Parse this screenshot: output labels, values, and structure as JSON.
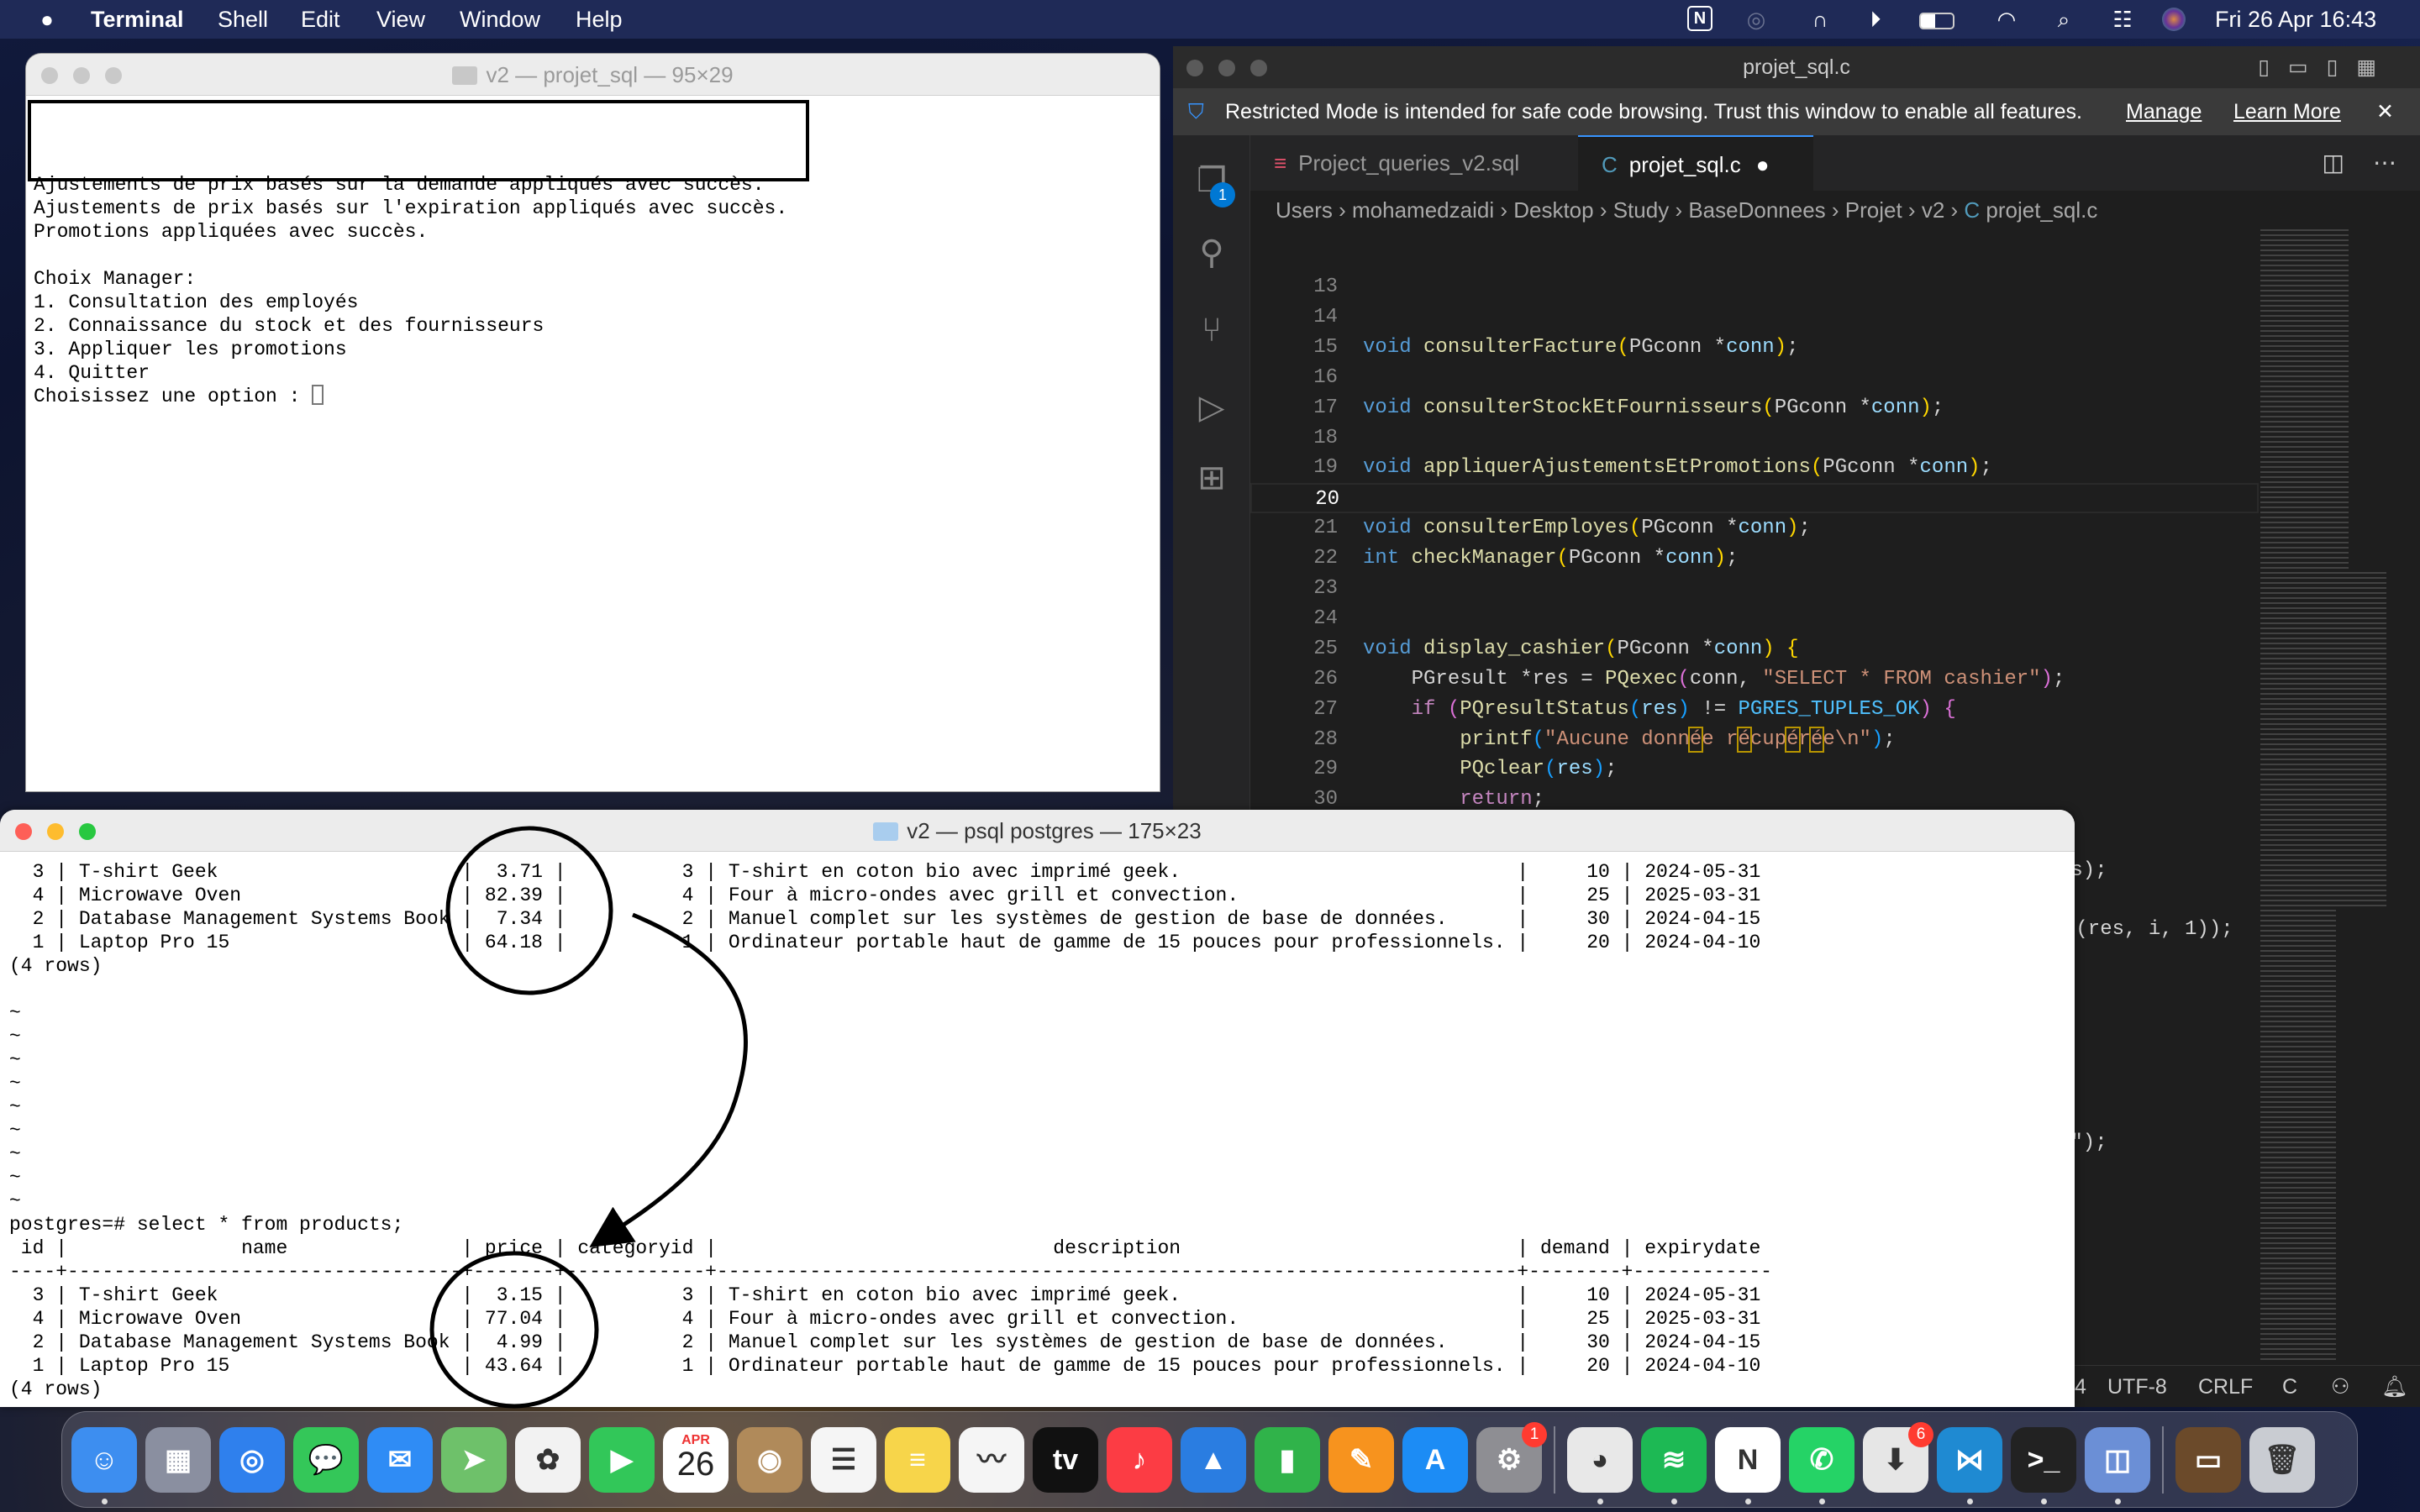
{
  "menubar": {
    "app": "Terminal",
    "items": [
      "Shell",
      "Edit",
      "View",
      "Window",
      "Help"
    ],
    "clock": "Fri 26 Apr  16:43",
    "status_icons": [
      "notion-icon",
      "airdrop-icon",
      "headphones-icon",
      "play-icon",
      "battery-icon",
      "wifi-icon",
      "search-icon",
      "control-center-icon",
      "siri-icon"
    ]
  },
  "term1": {
    "title": "v2 — projet_sql — 95×29",
    "lines": [
      "Ajustements de prix basés sur la demande appliqués avec succès.",
      "Ajustements de prix basés sur l'expiration appliqués avec succès.",
      "Promotions appliquées avec succès.",
      "",
      "Choix Manager:",
      "1. Consultation des employés",
      "2. Connaissance du stock et des fournisseurs",
      "3. Appliquer les promotions",
      "4. Quitter"
    ],
    "prompt": "Choisissez une option : "
  },
  "vscode": {
    "title": "projet_sql.c",
    "banner": {
      "text": "Restricted Mode is intended for safe code browsing. Trust this window to enable all features.",
      "manage": "Manage",
      "learn_more": "Learn More"
    },
    "explorer_badge": "1",
    "tabs": [
      {
        "label": "Project_queries_v2.sql",
        "icon": "database-icon"
      },
      {
        "label": "projet_sql.c",
        "icon": "c-file-icon",
        "active": true,
        "modified": true
      }
    ],
    "breadcrumb": [
      "Users",
      "mohamedzaidi",
      "Desktop",
      "Study",
      "BaseDonnees",
      "Projet",
      "v2",
      "projet_sql.c"
    ],
    "current_line": 20,
    "code": [
      {
        "n": "13",
        "t": []
      },
      {
        "n": "14",
        "t": []
      },
      {
        "n": "15",
        "t": [
          [
            "void",
            "k"
          ],
          [
            " ",
            "t"
          ],
          [
            "consulterFacture",
            "f"
          ],
          [
            "(",
            "b1"
          ],
          [
            "PGconn *",
            "t"
          ],
          [
            "conn",
            "v"
          ],
          [
            ")",
            "b1"
          ],
          [
            ";",
            "t"
          ]
        ]
      },
      {
        "n": "16",
        "t": []
      },
      {
        "n": "17",
        "t": [
          [
            "void",
            "k"
          ],
          [
            " ",
            "t"
          ],
          [
            "consulterStockEtFournisseurs",
            "f"
          ],
          [
            "(",
            "b1"
          ],
          [
            "PGconn *",
            "t"
          ],
          [
            "conn",
            "v"
          ],
          [
            ")",
            "b1"
          ],
          [
            ";",
            "t"
          ]
        ]
      },
      {
        "n": "18",
        "t": []
      },
      {
        "n": "19",
        "t": [
          [
            "void",
            "k"
          ],
          [
            " ",
            "t"
          ],
          [
            "appliquerAjustementsEtPromotions",
            "f"
          ],
          [
            "(",
            "b1"
          ],
          [
            "PGconn *",
            "t"
          ],
          [
            "conn",
            "v"
          ],
          [
            ")",
            "b1"
          ],
          [
            ";",
            "t"
          ]
        ]
      },
      {
        "n": "20",
        "t": []
      },
      {
        "n": "21",
        "t": [
          [
            "void",
            "k"
          ],
          [
            " ",
            "t"
          ],
          [
            "consulterEmployes",
            "f"
          ],
          [
            "(",
            "b1"
          ],
          [
            "PGconn *",
            "t"
          ],
          [
            "conn",
            "v"
          ],
          [
            ")",
            "b1"
          ],
          [
            ";",
            "t"
          ]
        ]
      },
      {
        "n": "22",
        "t": [
          [
            "int",
            "k"
          ],
          [
            " ",
            "t"
          ],
          [
            "checkManager",
            "f"
          ],
          [
            "(",
            "b1"
          ],
          [
            "PGconn *",
            "t"
          ],
          [
            "conn",
            "v"
          ],
          [
            ")",
            "b1"
          ],
          [
            ";",
            "t"
          ]
        ]
      },
      {
        "n": "23",
        "t": []
      },
      {
        "n": "24",
        "t": []
      },
      {
        "n": "25",
        "t": [
          [
            "void",
            "k"
          ],
          [
            " ",
            "t"
          ],
          [
            "display_cashier",
            "f"
          ],
          [
            "(",
            "b1"
          ],
          [
            "PGconn *",
            "t"
          ],
          [
            "conn",
            "v"
          ],
          [
            ")",
            "b1"
          ],
          [
            " ",
            "t"
          ],
          [
            "{",
            "b1"
          ]
        ]
      },
      {
        "n": "26",
        "t": [
          [
            "    PGresult *res = ",
            "t"
          ],
          [
            "PQexec",
            "f"
          ],
          [
            "(",
            "b2"
          ],
          [
            "conn, ",
            "t"
          ],
          [
            "\"SELECT * FROM cashier\"",
            "s"
          ],
          [
            ")",
            "b2"
          ],
          [
            ";",
            "t"
          ]
        ]
      },
      {
        "n": "27",
        "t": [
          [
            "    ",
            "t"
          ],
          [
            "if",
            "c"
          ],
          [
            " ",
            "t"
          ],
          [
            "(",
            "b2"
          ],
          [
            "PQresultStatus",
            "f"
          ],
          [
            "(",
            "b3"
          ],
          [
            "res",
            "v"
          ],
          [
            ")",
            "b3"
          ],
          [
            " != ",
            "t"
          ],
          [
            "PGRES_TUPLES_OK",
            "e"
          ],
          [
            ")",
            "b2"
          ],
          [
            " ",
            "t"
          ],
          [
            "{",
            "b2"
          ]
        ]
      },
      {
        "n": "28",
        "t": [
          [
            "        ",
            "t"
          ],
          [
            "printf",
            "f"
          ],
          [
            "(",
            "b3"
          ],
          [
            "\"Aucune donnée récupérée\\n\"",
            "s"
          ],
          [
            ")",
            "b3"
          ],
          [
            ";",
            "t"
          ]
        ]
      },
      {
        "n": "29",
        "t": [
          [
            "        ",
            "t"
          ],
          [
            "PQclear",
            "f"
          ],
          [
            "(",
            "b3"
          ],
          [
            "res",
            "v"
          ],
          [
            ")",
            "b3"
          ],
          [
            ";",
            "t"
          ]
        ]
      },
      {
        "n": "30",
        "t": [
          [
            "        ",
            "t"
          ],
          [
            "return",
            "c"
          ],
          [
            ";",
            "t"
          ]
        ]
      },
      {
        "n": "31",
        "t": [
          [
            "    ",
            "t"
          ],
          [
            "}",
            "b2"
          ]
        ]
      }
    ],
    "hidden_fragments": [
      "ys);",
      "e(res, i, 1));",
      "n\");"
    ],
    "status": [
      "4",
      "UTF-8",
      "CRLF",
      "C"
    ]
  },
  "term2": {
    "title": "v2 — psql postgres — 175×23",
    "columns": [
      {
        "h": "id",
        "w": 2,
        "a": "r"
      },
      {
        "h": "name",
        "w": 32,
        "a": "l"
      },
      {
        "h": "price",
        "w": 5,
        "a": "r"
      },
      {
        "h": "categoryid",
        "w": 10,
        "a": "r"
      },
      {
        "h": "description",
        "w": 67,
        "a": "l"
      },
      {
        "h": "demand",
        "w": 6,
        "a": "r"
      },
      {
        "h": "expirydate",
        "w": 10,
        "a": "l"
      }
    ],
    "before_rows": [
      [
        "3",
        "T-shirt Geek",
        "3.71",
        "3",
        "T-shirt en coton bio avec imprimé geek.",
        "10",
        "2024-05-31"
      ],
      [
        "4",
        "Microwave Oven",
        "82.39",
        "4",
        "Four à micro-ondes avec grill et convection.",
        "25",
        "2025-03-31"
      ],
      [
        "2",
        "Database Management Systems Book",
        "7.34",
        "2",
        "Manuel complet sur les systèmes de gestion de base de données.",
        "30",
        "2024-04-15"
      ],
      [
        "1",
        "Laptop Pro 15",
        "64.18",
        "1",
        "Ordinateur portable haut de gamme de 15 pouces pour professionnels.",
        "20",
        "2024-04-10"
      ]
    ],
    "footer": "(4 rows)",
    "tildes": [
      "~",
      "~",
      "~",
      "~",
      "~",
      "~",
      "~",
      "~",
      "~"
    ],
    "prompt": "postgres=# select * from products;",
    "after_rows": [
      [
        "3",
        "T-shirt Geek",
        "3.15",
        "3",
        "T-shirt en coton bio avec imprimé geek.",
        "10",
        "2024-05-31"
      ],
      [
        "4",
        "Microwave Oven",
        "77.04",
        "4",
        "Four à micro-ondes avec grill et convection.",
        "25",
        "2025-03-31"
      ],
      [
        "2",
        "Database Management Systems Book",
        "4.99",
        "2",
        "Manuel complet sur les systèmes de gestion de base de données.",
        "30",
        "2024-04-15"
      ],
      [
        "1",
        "Laptop Pro 15",
        "43.64",
        "1",
        "Ordinateur portable haut de gamme de 15 pouces pour professionnels.",
        "20",
        "2024-04-10"
      ]
    ],
    "footer_after": "(4 rows)"
  },
  "dock": {
    "calendar": {
      "month": "APR",
      "day": "26"
    },
    "apps": [
      {
        "name": "finder",
        "color": "#3d8ef0",
        "glyph": "☺",
        "dot": true
      },
      {
        "name": "launchpad",
        "color": "#8a8fa0",
        "glyph": "▦"
      },
      {
        "name": "safari",
        "color": "#2f80ed",
        "glyph": "◎"
      },
      {
        "name": "messages",
        "color": "#34c759",
        "glyph": "💬"
      },
      {
        "name": "mail",
        "color": "#2f8cf5",
        "glyph": "✉"
      },
      {
        "name": "maps",
        "color": "#6ec16a",
        "glyph": "➤"
      },
      {
        "name": "photos",
        "color": "#f2f2f2",
        "glyph": "✿"
      },
      {
        "name": "facetime",
        "color": "#32c759",
        "glyph": "▶"
      },
      {
        "name": "calendar",
        "color": "#ffffff",
        "glyph": ""
      },
      {
        "name": "contacts",
        "color": "#b08a5a",
        "glyph": "◉"
      },
      {
        "name": "reminders",
        "color": "#f5f5f5",
        "glyph": "☰"
      },
      {
        "name": "notes",
        "color": "#f7d54a",
        "glyph": "≡"
      },
      {
        "name": "freeform",
        "color": "#f5f5f5",
        "glyph": "〰"
      },
      {
        "name": "apple-tv",
        "color": "#111111",
        "glyph": "tv"
      },
      {
        "name": "music",
        "color": "#fc3c44",
        "glyph": "♪"
      },
      {
        "name": "keynote",
        "color": "#2a7de1",
        "glyph": "▲"
      },
      {
        "name": "numbers",
        "color": "#30b34a",
        "glyph": "▮"
      },
      {
        "name": "pages",
        "color": "#f7931e",
        "glyph": "✎"
      },
      {
        "name": "app-store",
        "color": "#1c8cf5",
        "glyph": "A"
      },
      {
        "name": "system-settings",
        "color": "#8e8e93",
        "glyph": "⚙",
        "badge": "1"
      },
      {
        "sep": true
      },
      {
        "name": "chrome",
        "color": "#e8e8e8",
        "glyph": "◕",
        "dot": true
      },
      {
        "name": "spotify",
        "color": "#1db954",
        "glyph": "≋",
        "dot": true
      },
      {
        "name": "notion",
        "color": "#ffffff",
        "glyph": "N",
        "dot": true
      },
      {
        "name": "whatsapp",
        "color": "#25d366",
        "glyph": "✆",
        "dot": true
      },
      {
        "name": "office-installer",
        "color": "#e6e6e6",
        "glyph": "⬇",
        "badge": "6"
      },
      {
        "name": "vscode",
        "color": "#1f8ad2",
        "glyph": "⋈",
        "dot": true
      },
      {
        "name": "terminal",
        "color": "#222222",
        "glyph": ">_",
        "dot": true
      },
      {
        "name": "preview",
        "color": "#6b8fd6",
        "glyph": "◫",
        "dot": true
      },
      {
        "sep": true
      },
      {
        "name": "downloads-stack",
        "color": "#6b4a2a",
        "glyph": "▭"
      },
      {
        "name": "trash",
        "color": "#c9ccd2",
        "glyph": "🗑"
      }
    ]
  },
  "colors": {
    "menubar": "#1f2a57",
    "vscode_bg": "#1e1e1e",
    "accent": "#3794ff",
    "annotation": "#000000"
  }
}
